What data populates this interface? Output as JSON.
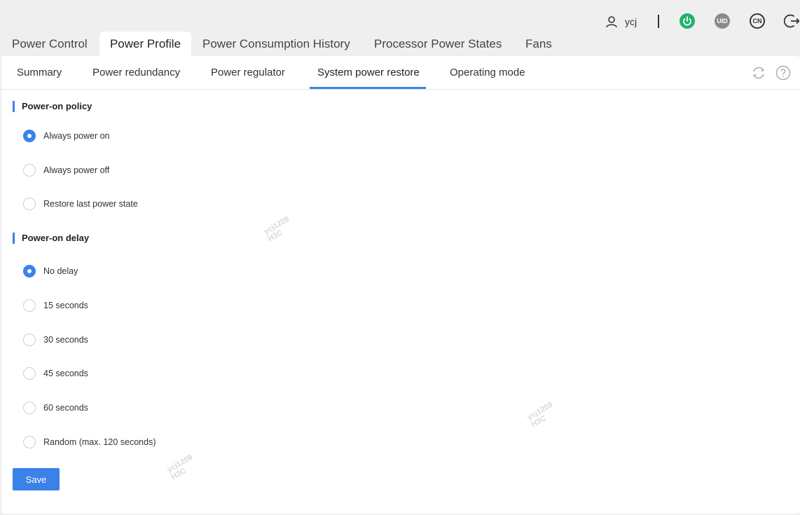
{
  "header": {
    "username": "ycj",
    "icons": [
      "user-icon",
      "power-icon",
      "uid-icon",
      "language-icon",
      "logout-icon"
    ],
    "uid_label": "UID",
    "lang_label": "CN",
    "power_color": "#1cb469"
  },
  "main_tabs": [
    {
      "label": "Power Control"
    },
    {
      "label": "Power Profile",
      "active": true
    },
    {
      "label": "Power Consumption History"
    },
    {
      "label": "Processor Power States"
    },
    {
      "label": "Fans"
    }
  ],
  "sub_tabs": [
    {
      "label": "Summary"
    },
    {
      "label": "Power redundancy"
    },
    {
      "label": "Power regulator"
    },
    {
      "label": "System power restore",
      "active": true
    },
    {
      "label": "Operating mode"
    }
  ],
  "power_on_policy": {
    "title": "Power-on policy",
    "options": [
      {
        "label": "Always power on",
        "checked": true
      },
      {
        "label": "Always power off",
        "checked": false
      },
      {
        "label": "Restore last power state",
        "checked": false
      }
    ]
  },
  "power_on_delay": {
    "title": "Power-on delay",
    "options": [
      {
        "label": "No delay",
        "checked": true
      },
      {
        "label": "15 seconds",
        "checked": false
      },
      {
        "label": "30 seconds",
        "checked": false
      },
      {
        "label": "45 seconds",
        "checked": false
      },
      {
        "label": "60 seconds",
        "checked": false
      },
      {
        "label": "Random (max. 120 seconds)",
        "checked": false
      }
    ]
  },
  "save_label": "Save",
  "watermark": {
    "line1": "ycj1209",
    "line2": "H3C"
  },
  "accent_color": "#3b82e8"
}
